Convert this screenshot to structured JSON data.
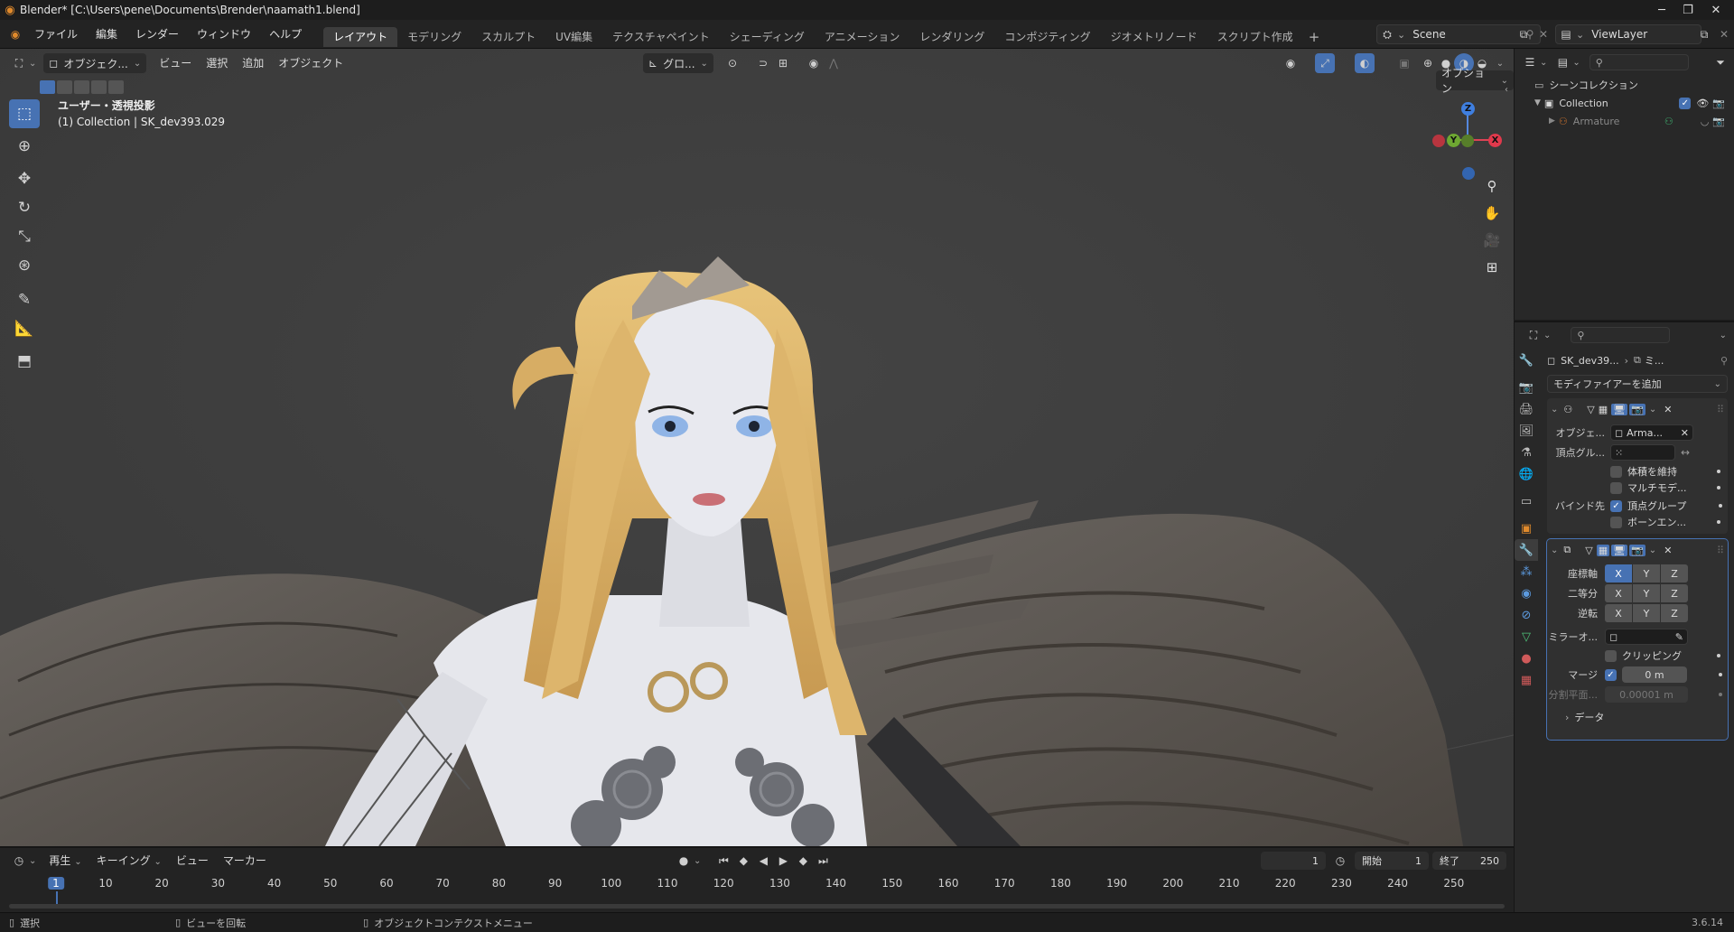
{
  "window": {
    "title": "Blender* [C:\\Users\\pene\\Documents\\Brender\\naamath1.blend]"
  },
  "menu": [
    "ファイル",
    "編集",
    "レンダー",
    "ウィンドウ",
    "ヘルプ"
  ],
  "workspaces": [
    "レイアウト",
    "モデリング",
    "スカルプト",
    "UV編集",
    "テクスチャペイント",
    "シェーディング",
    "アニメーション",
    "レンダリング",
    "コンポジティング",
    "ジオメトリノード",
    "スクリプト作成"
  ],
  "scene": {
    "name": "Scene",
    "view_layer": "ViewLayer"
  },
  "viewport": {
    "mode": "オブジェク...",
    "menus": [
      "ビュー",
      "選択",
      "追加",
      "オブジェクト"
    ],
    "transform_orientation": "グロ...",
    "projection": "ユーザー・透視投影",
    "collection_info": "(1) Collection | SK_dev393.029",
    "options": "オプション",
    "gizmo_axes": {
      "z": "Z",
      "y": "Y",
      "x": "X"
    }
  },
  "outliner": {
    "root": "シーンコレクション",
    "collection": "Collection",
    "item": "Armature"
  },
  "properties": {
    "breadcrumb_object": "SK_dev39...",
    "breadcrumb_modifier": "ミ...",
    "add_modifier": "モディファイアーを追加",
    "armature": {
      "object_label": "オブジェ...",
      "object_value": "Arma...",
      "vertex_group_label": "頂点グル...",
      "preserve_volume": "体積を維持",
      "multi_modifier": "マルチモデ...",
      "bind_to": "バインド先",
      "vertex_groups": "頂点グループ",
      "bone_envelopes": "ボーンエン..."
    },
    "mirror": {
      "axis": "座標軸",
      "bisect": "二等分",
      "flip": "逆転",
      "mirror_object": "ミラーオ...",
      "clipping": "クリッピング",
      "merge": "マージ",
      "merge_value": "0 m",
      "bisect_distance": "分割平面...",
      "bisect_distance_value": "0.00001 m",
      "data": "データ",
      "x": "X",
      "y": "Y",
      "z": "Z"
    }
  },
  "timeline": {
    "menus": [
      "再生",
      "キーイング",
      "ビュー",
      "マーカー"
    ],
    "current_frame": "1",
    "start_label": "開始",
    "start": "1",
    "end_label": "終了",
    "end": "250",
    "ticks": [
      "1",
      "10",
      "20",
      "30",
      "40",
      "50",
      "60",
      "70",
      "80",
      "90",
      "100",
      "110",
      "120",
      "130",
      "140",
      "150",
      "160",
      "170",
      "180",
      "190",
      "200",
      "210",
      "220",
      "230",
      "240",
      "250"
    ]
  },
  "status": {
    "select": "選択",
    "rotate": "ビューを回転",
    "context_menu": "オブジェクトコンテクストメニュー",
    "version": "3.6.14"
  }
}
